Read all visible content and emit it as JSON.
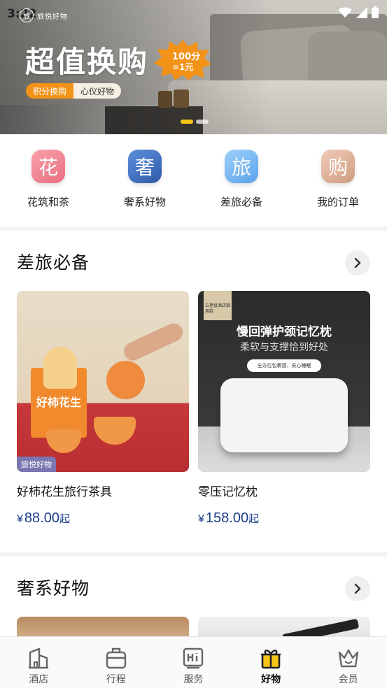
{
  "status_bar": {
    "time": "3:22"
  },
  "banner": {
    "logo_text": "旅悦好物",
    "title": "超值换购",
    "burst_line1": "100分",
    "burst_line2": "=1元",
    "tag_primary": "积分换购",
    "tag_secondary": "心仪好物",
    "accent_color": "#f29318"
  },
  "quick_entries": [
    {
      "glyph": "花",
      "label": "花筑和茶",
      "color": "#f07f8c"
    },
    {
      "glyph": "奢",
      "label": "奢系好物",
      "color": "#3e6fc0"
    },
    {
      "glyph": "旅",
      "label": "差旅必备",
      "color": "#6fb2ef"
    },
    {
      "glyph": "购",
      "label": "我的订单",
      "color": "#d9a88e"
    }
  ],
  "sections": [
    {
      "title": "差旅必备",
      "products": [
        {
          "name": "好柿花生旅行茶具",
          "currency": "¥",
          "price": "88.00",
          "suffix": "起",
          "badge": "旅悦好物",
          "img_text": "好柿花生"
        },
        {
          "name": "零压记忆枕",
          "currency": "¥",
          "price": "158.00",
          "suffix": "起",
          "img_title": "慢回弹护颈记忆枕",
          "img_subtitle": "柔软与支撑恰到好处",
          "img_pill": "全方位包裹感，安心睡眠",
          "img_ribbon": "五星级酒店御用款"
        }
      ]
    },
    {
      "title": "奢系好物",
      "products": []
    }
  ],
  "bottom_nav": [
    {
      "label": "酒店",
      "icon": "hotel-icon",
      "active": false
    },
    {
      "label": "行程",
      "icon": "luggage-icon",
      "active": false
    },
    {
      "label": "服务",
      "icon": "service-icon",
      "active": false
    },
    {
      "label": "好物",
      "icon": "gift-icon",
      "active": true
    },
    {
      "label": "会员",
      "icon": "crown-icon",
      "active": false
    }
  ]
}
